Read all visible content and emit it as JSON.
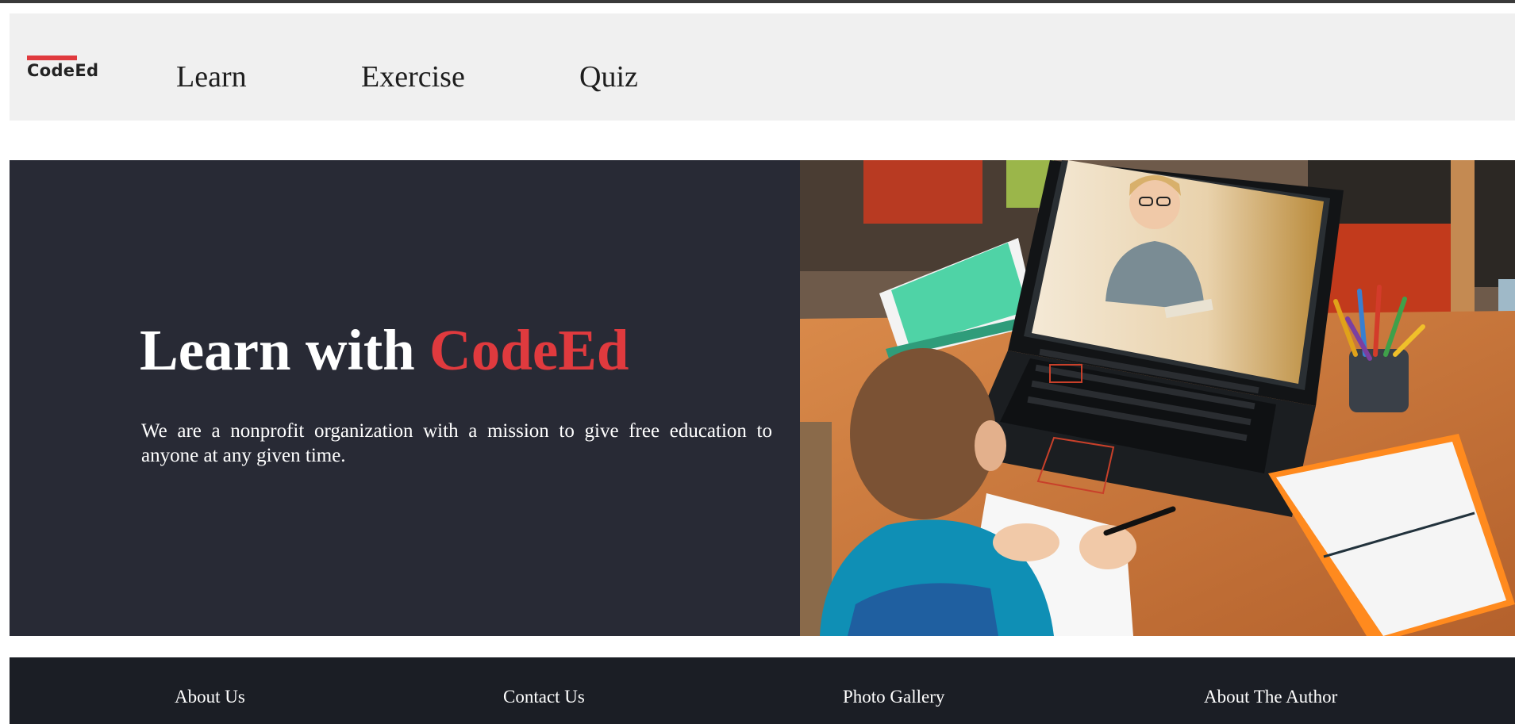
{
  "brand": {
    "logo_text": "CodeEd",
    "accent_color": "#e03a3e"
  },
  "nav": {
    "items": [
      {
        "label": "Learn"
      },
      {
        "label": "Exercise"
      },
      {
        "label": "Quiz"
      }
    ]
  },
  "hero": {
    "title_prefix": "Learn with ",
    "title_brand": "CodeEd",
    "description": "We are a nonprofit organization with a mission to give free education to anyone at any given time.",
    "background_color": "#282a35",
    "image_alt": "boy studying with teacher on laptop video call"
  },
  "footer": {
    "links": [
      {
        "label": "About Us"
      },
      {
        "label": "Contact Us"
      },
      {
        "label": "Photo Gallery"
      },
      {
        "label": "About The Author"
      }
    ],
    "background_color": "#1b1e25"
  }
}
